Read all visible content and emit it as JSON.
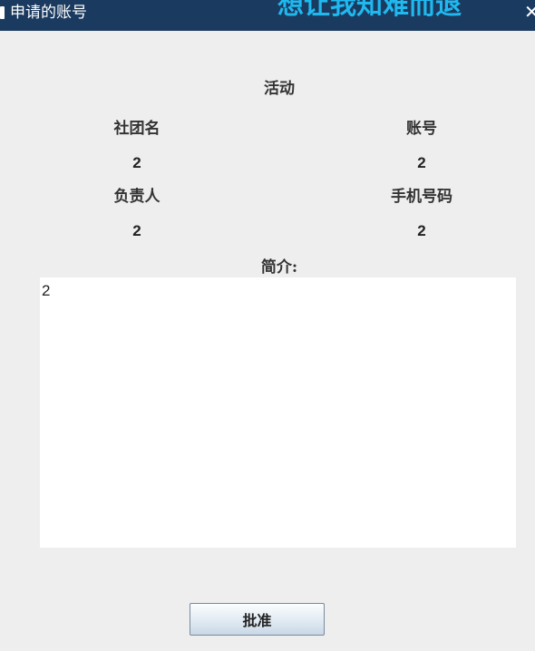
{
  "window": {
    "title": "申请的账号",
    "banner": "想让我知难而退",
    "close_symbol": "✕"
  },
  "form": {
    "heading": "活动",
    "club_name_label": "社团名",
    "club_name_value": "2",
    "account_label": "账号",
    "account_value": "2",
    "leader_label": "负责人",
    "leader_value": "2",
    "phone_label": "手机号码",
    "phone_value": "2",
    "intro_label": "简介:",
    "intro_value": "2"
  },
  "actions": {
    "approve_label": "批准"
  },
  "icons": {
    "app": "app-icon",
    "close": "close-icon"
  },
  "colors": {
    "titlebar_bg": "#1b3a5f",
    "banner_text": "#1fb8ef",
    "window_bg": "#eeeeee"
  }
}
